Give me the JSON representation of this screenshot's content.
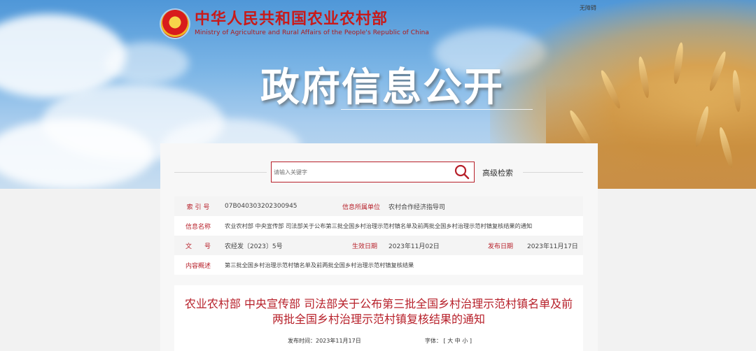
{
  "header": {
    "ministry_cn": "中华人民共和国农业农村部",
    "ministry_en": "Ministry of Agriculture and Rural Affairs of the People's Republic of China",
    "topright": "无障碍",
    "hero_title": "政府信息公开"
  },
  "search": {
    "placeholder": "请输入关键字",
    "advanced_label": "高级检索"
  },
  "info": {
    "index_label": "索 引 号",
    "index_value": "07B040303202300945",
    "unit_label": "信息所属单位",
    "unit_value": "农村合作经济指导司",
    "name_label": "信息名称",
    "name_value": "农业农村部 中央宣传部 司法部关于公布第三批全国乡村治理示范村镇名单及前两批全国乡村治理示范村镇复核结果的通知",
    "doc_label": "文　　号",
    "doc_value": "农经发〔2023〕5号",
    "effective_label": "生效日期",
    "effective_value": "2023年11月02日",
    "publish_label": "发布日期",
    "publish_value": "2023年11月17日",
    "summary_label": "内容概述",
    "summary_value": "第三批全国乡村治理示范村镇名单及前两批全国乡村治理示范村镇复核结果"
  },
  "doc": {
    "title": "农业农村部 中央宣传部 司法部关于公布第三批全国乡村治理示范村镇名单及前两批全国乡村治理示范村镇复核结果的通知",
    "publish_time": "发布时间：2023年11月17日",
    "font_label": "字体：",
    "font_open": "[",
    "font_large": "大",
    "font_medium": "中",
    "font_small": "小",
    "font_close": "]"
  },
  "colors": {
    "accent": "#b7202a",
    "title_red": "#c81a1a"
  }
}
